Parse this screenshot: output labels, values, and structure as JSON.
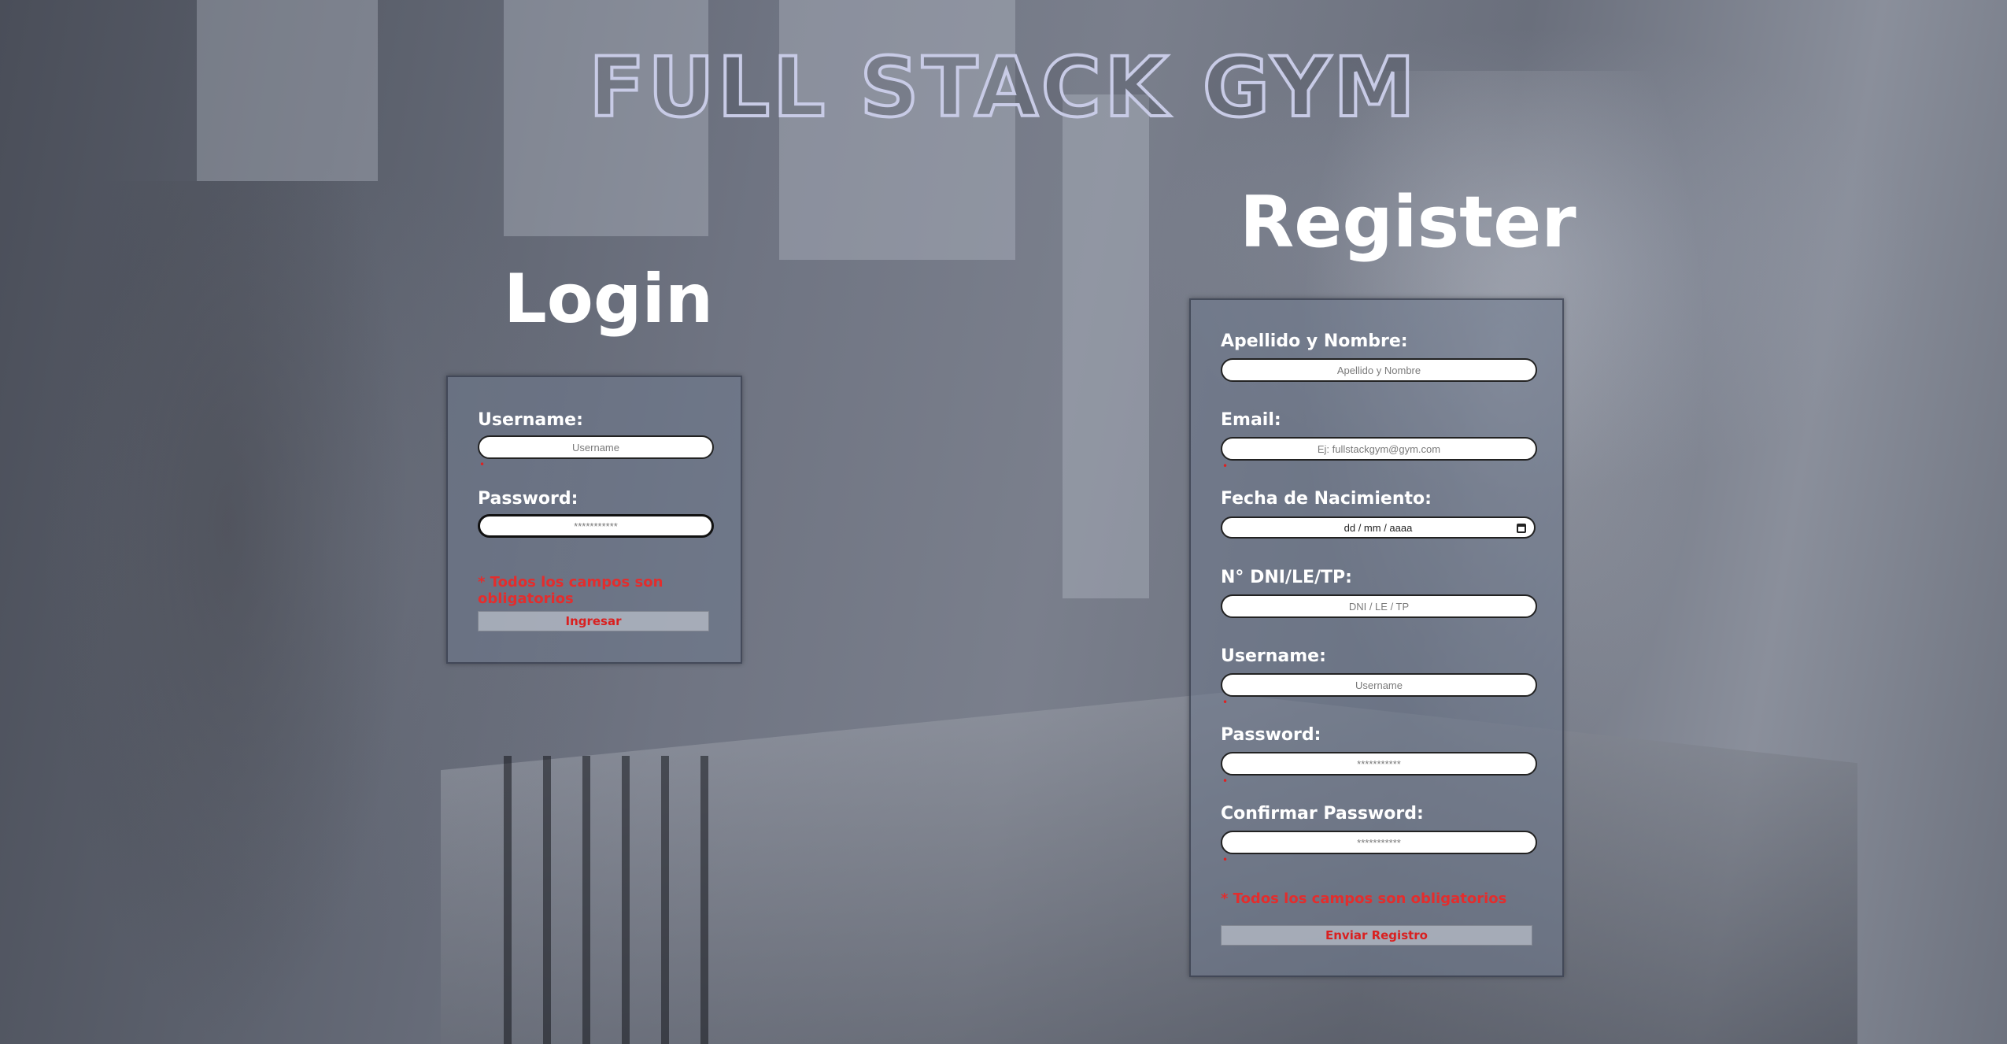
{
  "header": {
    "title": "FULL STACK GYM"
  },
  "login": {
    "heading": "Login",
    "username_label": "Username:",
    "username_placeholder": "Username",
    "password_label": "Password:",
    "password_placeholder": "***********",
    "required_note": "* Todos los campos son obligatorios",
    "submit_label": "Ingresar"
  },
  "register": {
    "heading": "Register",
    "fullname_label": "Apellido y Nombre:",
    "fullname_placeholder": "Apellido y Nombre",
    "email_label": "Email:",
    "email_placeholder": "Ej: fullstackgym@gym.com",
    "birthdate_label": "Fecha de Nacimiento:",
    "birthdate_value": "dd / mm / aaaa",
    "dni_label": "N° DNI/LE/TP:",
    "dni_placeholder": "DNI / LE / TP",
    "username_label": "Username:",
    "username_placeholder": "Username",
    "password_label": "Password:",
    "password_placeholder": "***********",
    "confirm_label": "Confirmar Password:",
    "confirm_placeholder": "***********",
    "required_note": "* Todos los campos son obligatorios",
    "submit_label": "Enviar Registro"
  },
  "colors": {
    "accent_red": "#e32d2d",
    "title_outline": "#c8cbe6"
  }
}
